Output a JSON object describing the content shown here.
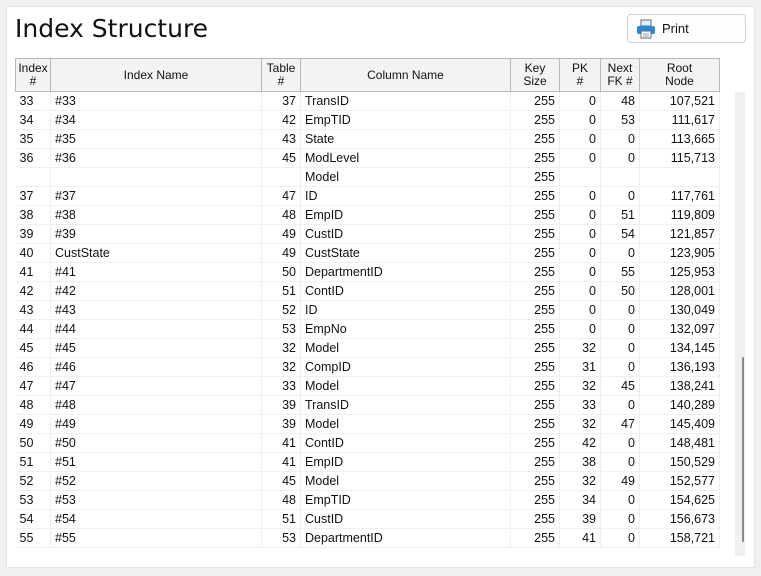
{
  "window": {
    "title": "Index Structure",
    "print_label": "Print"
  },
  "columns": [
    {
      "line1": "Index",
      "line2": "#"
    },
    {
      "line1": "Index Name",
      "line2": ""
    },
    {
      "line1": "Table",
      "line2": "#"
    },
    {
      "line1": "Column Name",
      "line2": ""
    },
    {
      "line1": "Key",
      "line2": "Size"
    },
    {
      "line1": "PK",
      "line2": "#"
    },
    {
      "line1": "Next",
      "line2": "FK #"
    },
    {
      "line1": "Root",
      "line2": "Node"
    }
  ],
  "rows": [
    [
      "33",
      "#33",
      "37",
      "TransID",
      "255",
      "0",
      "48",
      "107,521"
    ],
    [
      "34",
      "#34",
      "42",
      "EmpTID",
      "255",
      "0",
      "53",
      "111,617"
    ],
    [
      "35",
      "#35",
      "43",
      "State",
      "255",
      "0",
      "0",
      "113,665"
    ],
    [
      "36",
      "#36",
      "45",
      "ModLevel",
      "255",
      "0",
      "0",
      "115,713"
    ],
    [
      "",
      "",
      "",
      "Model",
      "255",
      "",
      "",
      ""
    ],
    [
      "37",
      "#37",
      "47",
      "ID",
      "255",
      "0",
      "0",
      "117,761"
    ],
    [
      "38",
      "#38",
      "48",
      "EmpID",
      "255",
      "0",
      "51",
      "119,809"
    ],
    [
      "39",
      "#39",
      "49",
      "CustID",
      "255",
      "0",
      "54",
      "121,857"
    ],
    [
      "40",
      "CustState",
      "49",
      "CustState",
      "255",
      "0",
      "0",
      "123,905"
    ],
    [
      "41",
      "#41",
      "50",
      "DepartmentID",
      "255",
      "0",
      "55",
      "125,953"
    ],
    [
      "42",
      "#42",
      "51",
      "ContID",
      "255",
      "0",
      "50",
      "128,001"
    ],
    [
      "43",
      "#43",
      "52",
      "ID",
      "255",
      "0",
      "0",
      "130,049"
    ],
    [
      "44",
      "#44",
      "53",
      "EmpNo",
      "255",
      "0",
      "0",
      "132,097"
    ],
    [
      "45",
      "#45",
      "32",
      "Model",
      "255",
      "32",
      "0",
      "134,145"
    ],
    [
      "46",
      "#46",
      "32",
      "CompID",
      "255",
      "31",
      "0",
      "136,193"
    ],
    [
      "47",
      "#47",
      "33",
      "Model",
      "255",
      "32",
      "45",
      "138,241"
    ],
    [
      "48",
      "#48",
      "39",
      "TransID",
      "255",
      "33",
      "0",
      "140,289"
    ],
    [
      "49",
      "#49",
      "39",
      "Model",
      "255",
      "32",
      "47",
      "145,409"
    ],
    [
      "50",
      "#50",
      "41",
      "ContID",
      "255",
      "42",
      "0",
      "148,481"
    ],
    [
      "51",
      "#51",
      "41",
      "EmpID",
      "255",
      "38",
      "0",
      "150,529"
    ],
    [
      "52",
      "#52",
      "45",
      "Model",
      "255",
      "32",
      "49",
      "152,577"
    ],
    [
      "53",
      "#53",
      "48",
      "EmpTID",
      "255",
      "34",
      "0",
      "154,625"
    ],
    [
      "54",
      "#54",
      "51",
      "CustID",
      "255",
      "39",
      "0",
      "156,673"
    ],
    [
      "55",
      "#55",
      "53",
      "DepartmentID",
      "255",
      "41",
      "0",
      "158,721"
    ]
  ],
  "colors": {
    "header_bg": "#f3f3f3",
    "printer_icon": "#2b88d8"
  },
  "icons": {
    "print": "printer-icon"
  }
}
